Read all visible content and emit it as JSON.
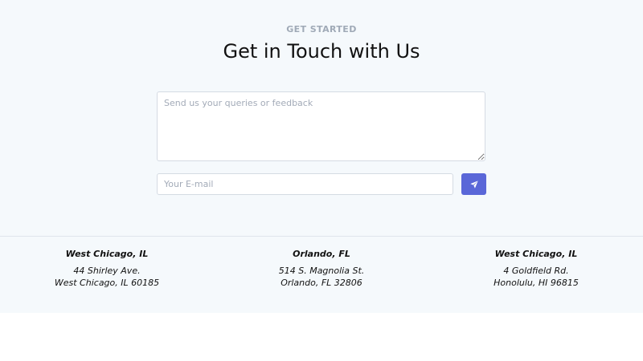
{
  "contact": {
    "eyebrow": "GET STARTED",
    "title": "Get in Touch with Us",
    "message_placeholder": "Send us your queries or feedback",
    "email_placeholder": "Your E-mail",
    "message_value": "",
    "email_value": "",
    "send_icon": "paper-plane-icon",
    "accent_color": "#5a67d8"
  },
  "offices": [
    {
      "city": "West Chicago, IL",
      "street": "44 Shirley Ave.",
      "locality": "West Chicago, IL 60185"
    },
    {
      "city": "Orlando, FL",
      "street": "514 S. Magnolia St.",
      "locality": "Orlando, FL 32806"
    },
    {
      "city": "West Chicago, IL",
      "street": "4 Goldfield Rd.",
      "locality": "Honolulu, HI 96815"
    }
  ]
}
